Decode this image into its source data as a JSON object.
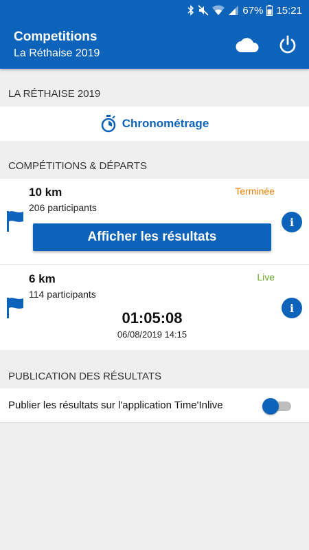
{
  "status_bar": {
    "battery": "67%",
    "time": "15:21",
    "icons": [
      "bluetooth-icon",
      "mute-icon",
      "wifi-icon",
      "signal-icon",
      "battery-icon"
    ]
  },
  "appbar": {
    "title": "Competitions",
    "subtitle": "La Réthaise 2019",
    "actions": [
      "cloud-icon",
      "power-icon"
    ]
  },
  "event_section": {
    "header": "LA RÉTHAISE 2019",
    "chrono_label": "Chronométrage",
    "chrono_icon": "stopwatch-icon"
  },
  "competitions_section": {
    "header": "COMPÉTITIONS & DÉPARTS",
    "items": [
      {
        "name": "10 km",
        "participants": "206 participants",
        "status": "Terminée",
        "status_color": "#f07c00",
        "action_label": "Afficher les résultats",
        "info_label": "i"
      },
      {
        "name": "6 km",
        "participants": "114 participants",
        "status": "Live",
        "status_color": "#6aaa2a",
        "timer": "01:05:08",
        "datetime": "06/08/2019 14:15",
        "info_label": "i"
      }
    ]
  },
  "publication_section": {
    "header": "PUBLICATION DES RÉSULTATS",
    "toggle_label": "Publier les résultats sur l'application Time'Inlive",
    "toggle_on": false
  },
  "colors": {
    "primary": "#0d63ba",
    "background": "#efefef"
  }
}
